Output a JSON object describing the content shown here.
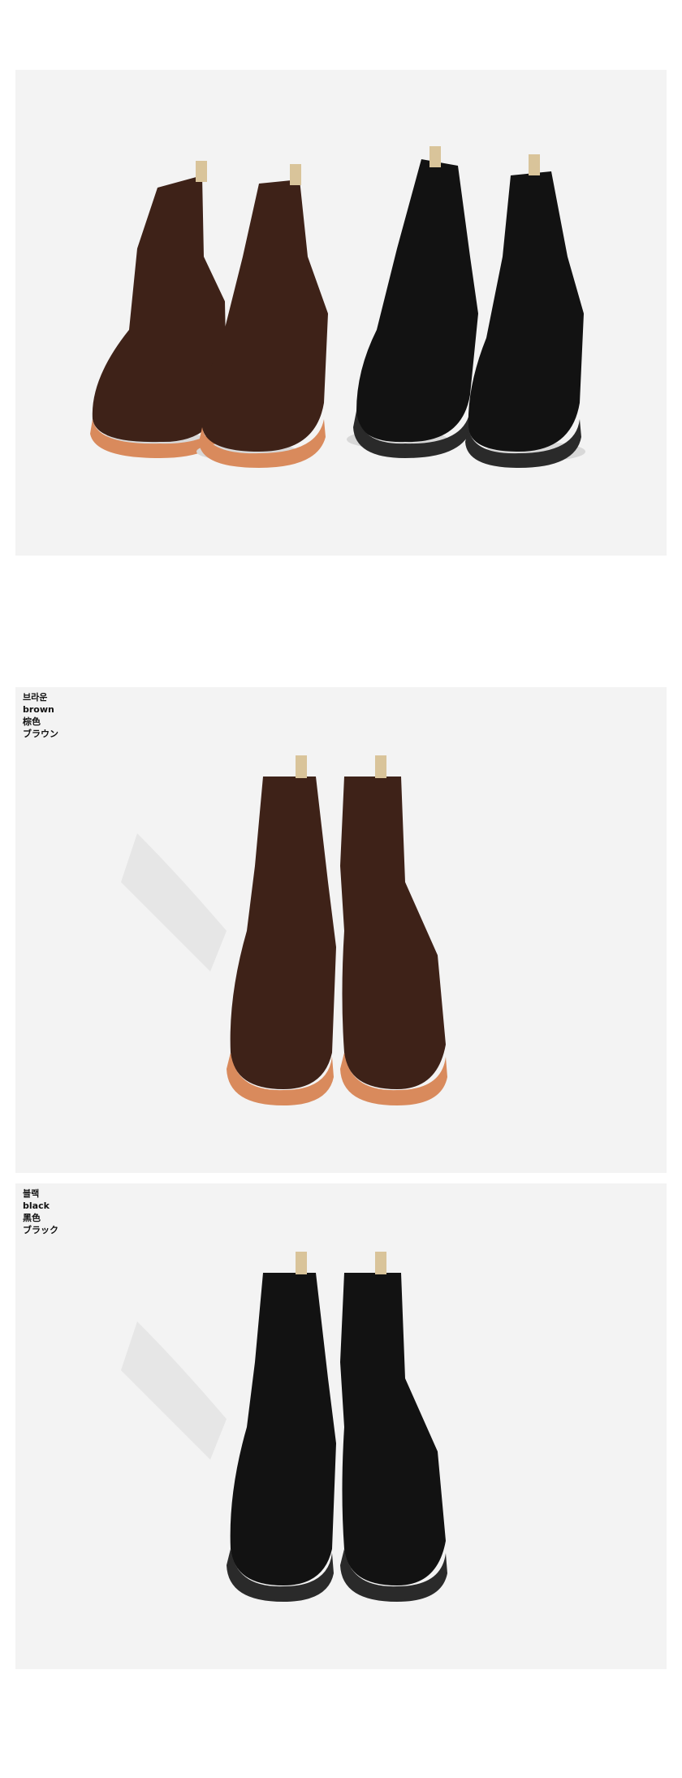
{
  "variants": [
    {
      "name_ko": "브라운",
      "name_en": "brown",
      "name_zh": "棕色",
      "name_ja": "ブラウン",
      "color": "#3e2218",
      "sole": "#d98a5c"
    },
    {
      "name_ko": "블랙",
      "name_en": "black",
      "name_zh": "黑色",
      "name_ja": "ブラック",
      "color": "#121212",
      "sole": "#2a2a2a"
    }
  ],
  "colors": {
    "panel_bg": "#f3f3f3",
    "page_bg": "#ffffff",
    "heel_tab": "#d9c49a"
  }
}
